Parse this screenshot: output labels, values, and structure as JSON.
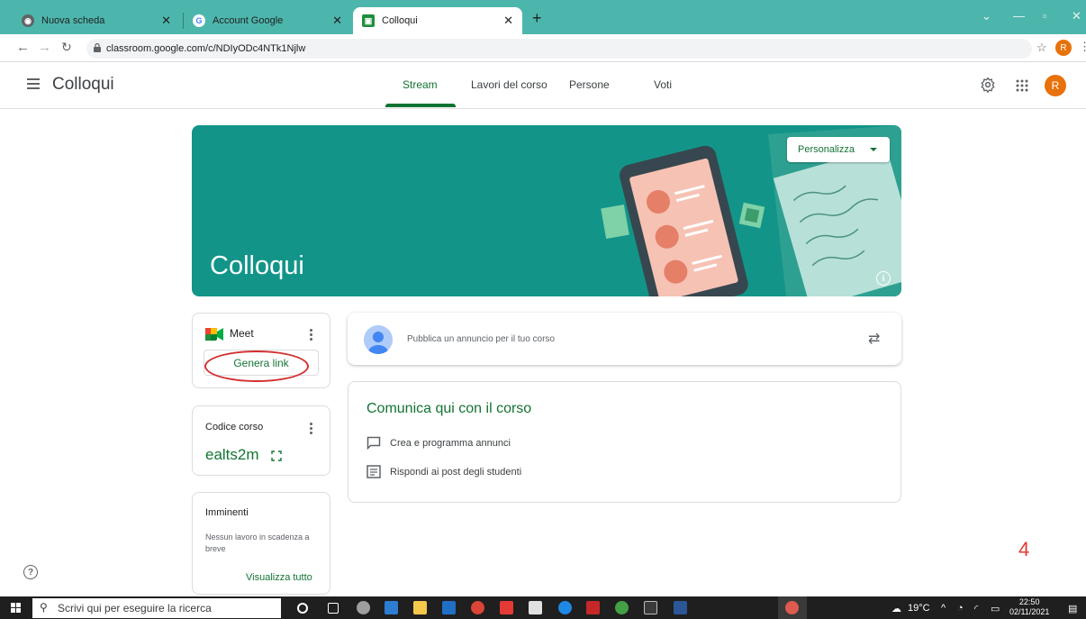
{
  "browser": {
    "tabs": [
      {
        "title": "Nuova scheda",
        "active": false
      },
      {
        "title": "Account Google",
        "active": false
      },
      {
        "title": "Colloqui",
        "active": true
      }
    ],
    "new_tab": "+",
    "url": "classroom.google.com/c/NDIyODc4NTk1Njlw",
    "profile_initial": "R"
  },
  "app": {
    "title": "Colloqui",
    "tabs": [
      {
        "label": "Stream",
        "active": true
      },
      {
        "label": "Lavori del corso",
        "active": false
      },
      {
        "label": "Persone",
        "active": false
      },
      {
        "label": "Voti",
        "active": false
      }
    ],
    "avatar_initial": "R",
    "accent_color": "#137333"
  },
  "banner": {
    "title": "Colloqui",
    "customize_label": "Personalizza",
    "color": "#129588"
  },
  "meet_card": {
    "title": "Meet",
    "button_label": "Genera link"
  },
  "code_card": {
    "label": "Codice corso",
    "code": "ealts2m"
  },
  "upcoming_card": {
    "title": "Imminenti",
    "empty_text": "Nessun lavoro in scadenza a breve",
    "view_all": "Visualizza tutto"
  },
  "post_box": {
    "placeholder": "Pubblica un annuncio per il tuo corso"
  },
  "communicate_card": {
    "title": "Comunica qui con il corso",
    "items": [
      "Crea e programma annunci",
      "Rispondi ai post degli studenti"
    ]
  },
  "annotation": {
    "page_number": "4"
  },
  "taskbar": {
    "search_placeholder": "Scrivi qui per eseguire la ricerca",
    "temperature": "19°C",
    "time": "22:50",
    "date": "02/11/2021"
  }
}
